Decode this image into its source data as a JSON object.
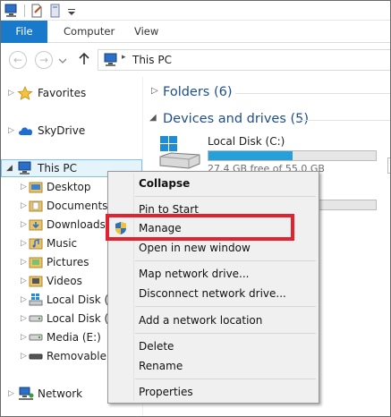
{
  "ribbon": {
    "tabs": [
      {
        "label": "File"
      },
      {
        "label": "Computer"
      },
      {
        "label": "View"
      }
    ]
  },
  "address": {
    "path": "This PC"
  },
  "nav": {
    "favorites": "Favorites",
    "skydrive": "SkyDrive",
    "thispc": "This PC",
    "children": [
      {
        "label": "Desktop"
      },
      {
        "label": "Documents"
      },
      {
        "label": "Downloads"
      },
      {
        "label": "Music"
      },
      {
        "label": "Pictures"
      },
      {
        "label": "Videos"
      },
      {
        "label": "Local Disk (C"
      },
      {
        "label": "Local Disk (D"
      },
      {
        "label": "Media (E:)"
      },
      {
        "label": "Removable D"
      }
    ],
    "network": "Network"
  },
  "main": {
    "folders_header": "Folders (6)",
    "devices_header": "Devices and drives (5)",
    "disk_c": {
      "name": "Local Disk (C:)",
      "free": "27.4 GB free of 55.0 GB",
      "used_fraction": 0.5
    }
  },
  "context_menu": {
    "items": [
      {
        "label": "Collapse"
      },
      {
        "label": "Pin to Start"
      },
      {
        "label": "Manage"
      },
      {
        "label": "Open in new window"
      },
      {
        "label": "Map network drive..."
      },
      {
        "label": "Disconnect network drive..."
      },
      {
        "label": "Add a network location"
      },
      {
        "label": "Delete"
      },
      {
        "label": "Rename"
      },
      {
        "label": "Properties"
      }
    ]
  },
  "colors": {
    "accent": "#1979ca",
    "highlight": "#e0232e",
    "group_header": "#1e4e8c",
    "disk_fill": "#26a0da"
  }
}
